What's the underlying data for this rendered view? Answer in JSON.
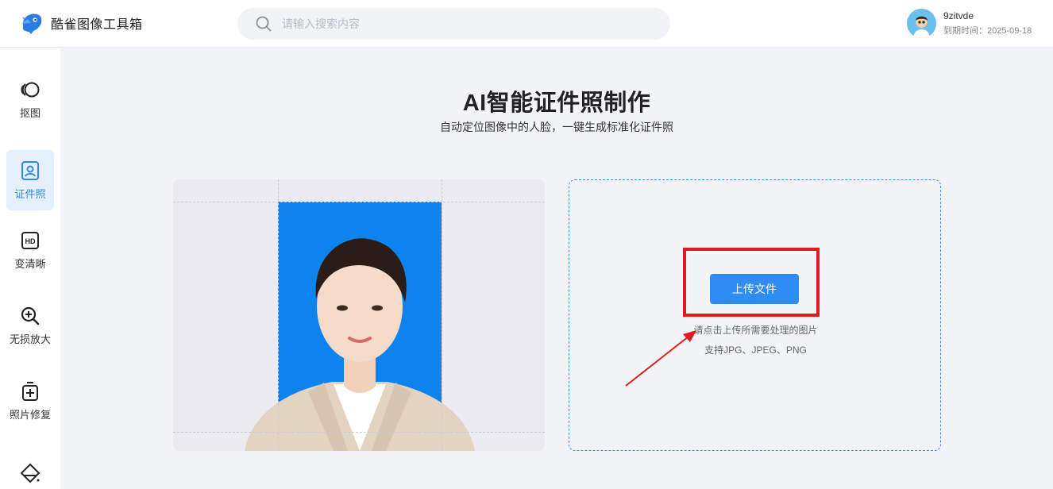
{
  "app": {
    "name": "酷雀图像工具箱"
  },
  "search": {
    "placeholder": "请输入搜索内容"
  },
  "user": {
    "name": "9zitvde",
    "expire": "到期时间：2025-09-18"
  },
  "sidebar": {
    "items": [
      {
        "label": "抠图",
        "icon": "cutout-icon"
      },
      {
        "label": "证件照",
        "icon": "id-photo-icon",
        "active": true
      },
      {
        "label": "变清晰",
        "icon": "hd-icon"
      },
      {
        "label": "无损放大",
        "icon": "zoom-in-icon"
      },
      {
        "label": "照片修复",
        "icon": "photo-repair-icon"
      },
      {
        "label": "",
        "icon": "eraser-icon"
      }
    ]
  },
  "main": {
    "title": "AI智能证件照制作",
    "subtitle": "自动定位图像中的人脸，一键生成标准化证件照"
  },
  "upload": {
    "button_label": "上传文件",
    "hint": "请点击上传所需要处理的图片",
    "formats": "支持JPG、JPEG、PNG"
  },
  "colors": {
    "accent": "#2f8cf2",
    "id_photo_background": "#0d83ee",
    "annotation_red": "#e01b1b"
  }
}
